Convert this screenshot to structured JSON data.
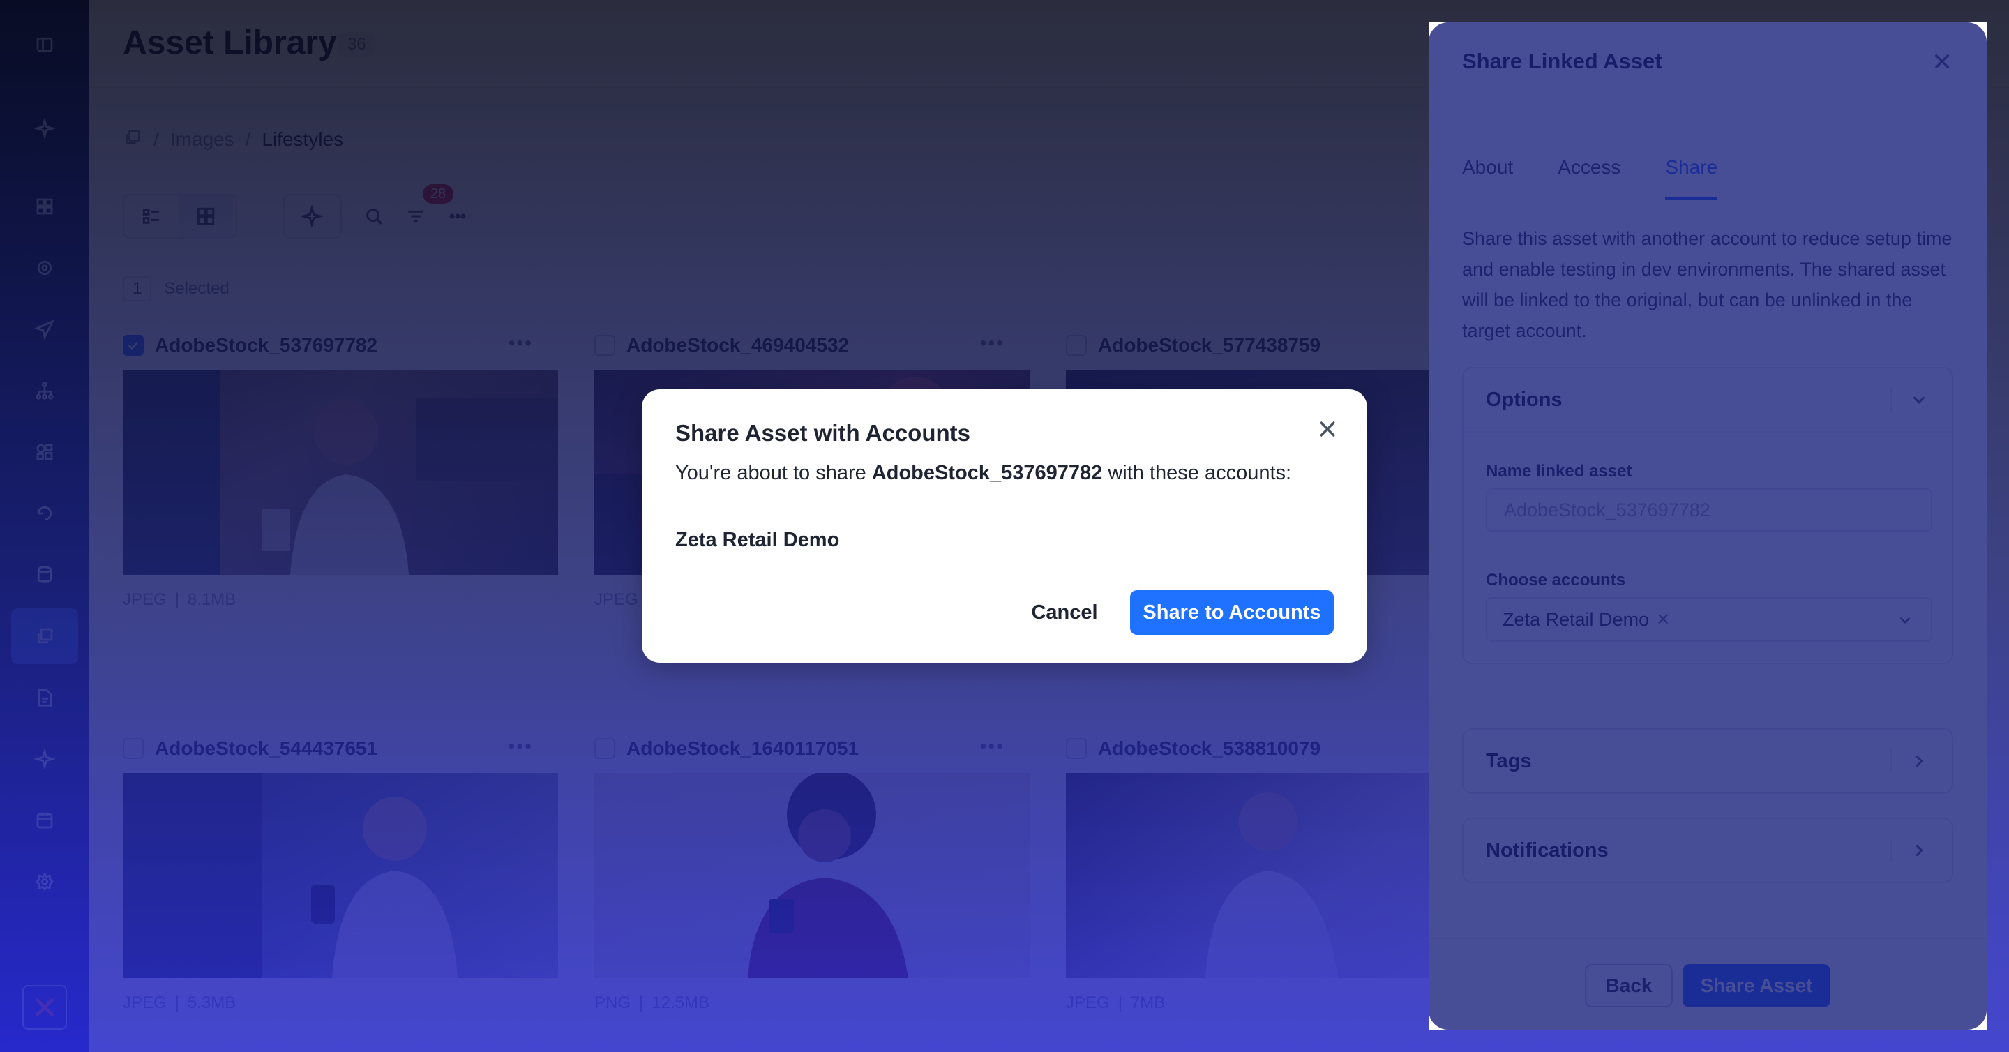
{
  "app": {
    "title": "Asset Library",
    "asset_count": "36"
  },
  "sidebar": {
    "items": [
      {
        "icon": "panel-toggle-icon"
      },
      {
        "icon": "sparkle-icon"
      },
      {
        "icon": "dashboard-icon"
      },
      {
        "icon": "target-icon"
      },
      {
        "icon": "send-icon"
      },
      {
        "icon": "hierarchy-icon"
      },
      {
        "icon": "segments-icon"
      },
      {
        "icon": "refresh-icon"
      },
      {
        "icon": "database-icon"
      },
      {
        "icon": "assets-icon",
        "active": true
      },
      {
        "icon": "document-icon"
      },
      {
        "icon": "sparkle-icon"
      },
      {
        "icon": "calendar-icon"
      },
      {
        "icon": "gear-icon"
      }
    ],
    "logo_icon": "zeta-logo-icon"
  },
  "breadcrumb": {
    "items": [
      "Images",
      "Lifestyles"
    ]
  },
  "toolbar": {
    "filter_count": "28"
  },
  "selection": {
    "count": "1",
    "label": "Selected"
  },
  "assets": [
    {
      "name": "AdobeStock_537697782",
      "format": "JPEG",
      "size": "8.1MB",
      "checked": true
    },
    {
      "name": "AdobeStock_469404532",
      "format": "JPEG",
      "size": "",
      "checked": false
    },
    {
      "name": "AdobeStock_577438759",
      "format": "",
      "size": "",
      "checked": false
    },
    {
      "name": "AdobeStock_544437651",
      "format": "JPEG",
      "size": "5.3MB",
      "checked": false
    },
    {
      "name": "AdobeStock_1640117051",
      "format": "PNG",
      "size": "12.5MB",
      "checked": false
    },
    {
      "name": "AdobeStock_538810079",
      "format": "JPEG",
      "size": "7MB",
      "checked": false
    }
  ],
  "drawer": {
    "title": "Share Linked Asset",
    "tabs": [
      "About",
      "Access",
      "Share"
    ],
    "active_tab": "Share",
    "description": "Share this asset with another account to reduce setup time and enable testing in dev environments. The shared asset will be linked to the original, but can be unlinked in the target account.",
    "options": {
      "title": "Options",
      "name_label": "Name linked asset",
      "name_placeholder": "AdobeStock_537697782",
      "accounts_label": "Choose accounts",
      "selected_account": "Zeta Retail Demo"
    },
    "tags_title": "Tags",
    "notifications_title": "Notifications",
    "back_label": "Back",
    "share_label": "Share Asset"
  },
  "modal": {
    "title": "Share Asset with Accounts",
    "msg_prefix": "You're about to share",
    "asset_name": "AdobeStock_537697782",
    "msg_suffix": "with these accounts:",
    "account": "Zeta Retail Demo",
    "cancel_label": "Cancel",
    "confirm_label": "Share to Accounts"
  }
}
